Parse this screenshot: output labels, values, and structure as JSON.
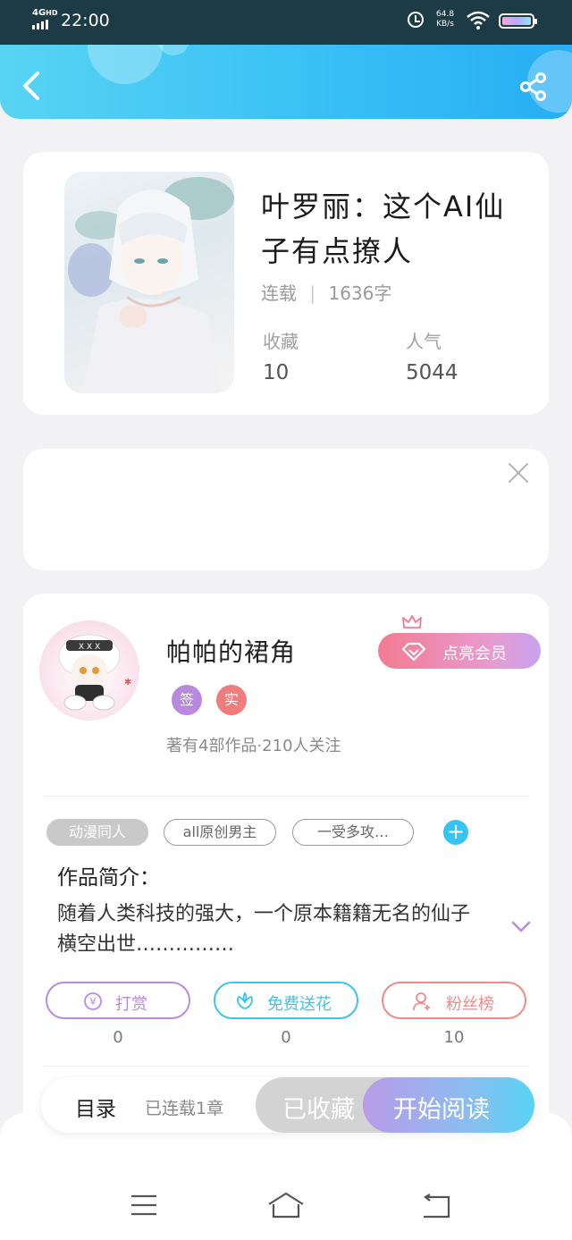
{
  "status_bar": {
    "network": "4G",
    "network_hd": "HD",
    "time": "22:00",
    "speed_value": "64.8",
    "speed_unit": "KB/s"
  },
  "header": {
    "back_icon": "chevron-left-icon",
    "share_icon": "share-icon"
  },
  "book": {
    "title": "叶罗丽：这个AI仙子有点撩人",
    "status": "连载",
    "word_count": "1636字",
    "stats": [
      {
        "label": "收藏",
        "value": "10"
      },
      {
        "label": "人气",
        "value": "5044"
      }
    ]
  },
  "ad": {
    "close_icon": "close-icon"
  },
  "author": {
    "name": "帕帕的裙角",
    "badges": [
      {
        "text": "签",
        "color": "#b889dc"
      },
      {
        "text": "实",
        "color": "#f07c7c"
      }
    ],
    "meta": "著有4部作品·210人关注",
    "vip_button": "点亮会员"
  },
  "tags": [
    {
      "text": "动漫同人",
      "style": "filled"
    },
    {
      "text": "all原创男主",
      "style": "outline"
    },
    {
      "text": "一受多攻…",
      "style": "outline"
    }
  ],
  "intro": {
    "label": "作品简介：",
    "text": "随着人类科技的强大，一个原本籍籍无名的仙子横空出世……………"
  },
  "actions": [
    {
      "label": "打赏",
      "icon": "yen-icon",
      "color": "#b98ae0",
      "count": "0"
    },
    {
      "label": "免费送花",
      "icon": "flower-icon",
      "color": "#3cc3ef",
      "count": "0"
    },
    {
      "label": "粉丝榜",
      "icon": "fan-user-icon",
      "color": "#f08a88",
      "count": "10"
    }
  ],
  "reading_bar": {
    "catalog": "目录",
    "chapters": "已连载1章",
    "favorited": "已收藏",
    "start": "开始阅读"
  },
  "nav": {
    "menu_icon": "menu-icon",
    "home_icon": "home-icon",
    "back_icon": "back-icon"
  }
}
